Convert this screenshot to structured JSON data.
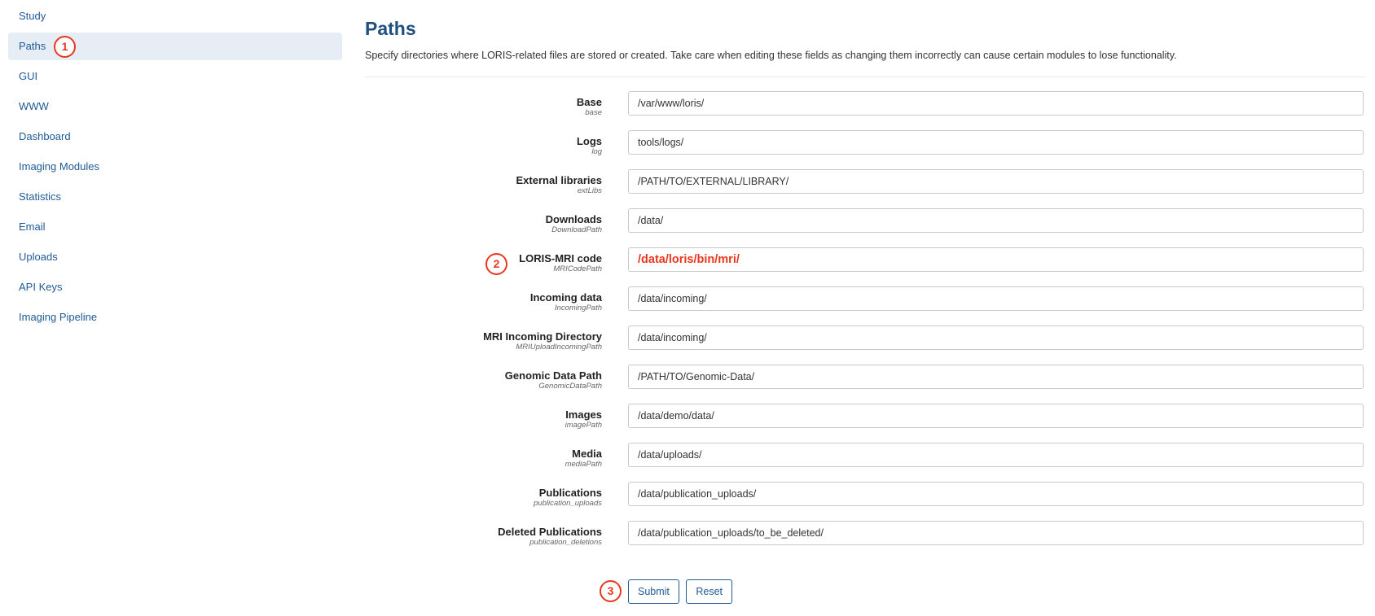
{
  "sidebar": {
    "items": [
      {
        "label": "Study"
      },
      {
        "label": "Paths"
      },
      {
        "label": "GUI"
      },
      {
        "label": "WWW"
      },
      {
        "label": "Dashboard"
      },
      {
        "label": "Imaging Modules"
      },
      {
        "label": "Statistics"
      },
      {
        "label": "Email"
      },
      {
        "label": "Uploads"
      },
      {
        "label": "API Keys"
      },
      {
        "label": "Imaging Pipeline"
      }
    ],
    "active": "Paths"
  },
  "main": {
    "title": "Paths",
    "description": "Specify directories where LORIS-related files are stored or created. Take care when editing these fields as changing them incorrectly can cause certain modules to lose functionality.",
    "fields": [
      {
        "label": "Base",
        "key": "base",
        "value": "/var/www/loris/"
      },
      {
        "label": "Logs",
        "key": "log",
        "value": "tools/logs/"
      },
      {
        "label": "External libraries",
        "key": "extLibs",
        "value": "/PATH/TO/EXTERNAL/LIBRARY/"
      },
      {
        "label": "Downloads",
        "key": "DownloadPath",
        "value": "/data/"
      },
      {
        "label": "LORIS-MRI code",
        "key": "MRICodePath",
        "value": "/data/loris/bin/mri/"
      },
      {
        "label": "Incoming data",
        "key": "IncomingPath",
        "value": "/data/incoming/"
      },
      {
        "label": "MRI Incoming Directory",
        "key": "MRIUploadIncomingPath",
        "value": "/data/incoming/"
      },
      {
        "label": "Genomic Data Path",
        "key": "GenomicDataPath",
        "value": "/PATH/TO/Genomic-Data/"
      },
      {
        "label": "Images",
        "key": "imagePath",
        "value": "/data/demo/data/"
      },
      {
        "label": "Media",
        "key": "mediaPath",
        "value": "/data/uploads/"
      },
      {
        "label": "Publications",
        "key": "publication_uploads",
        "value": "/data/publication_uploads/"
      },
      {
        "label": "Deleted Publications",
        "key": "publication_deletions",
        "value": "/data/publication_uploads/to_be_deleted/"
      }
    ],
    "submit_label": "Submit",
    "reset_label": "Reset"
  },
  "annotations": {
    "marker1": "1",
    "marker2": "2",
    "marker3": "3",
    "color": "#e8371f"
  }
}
